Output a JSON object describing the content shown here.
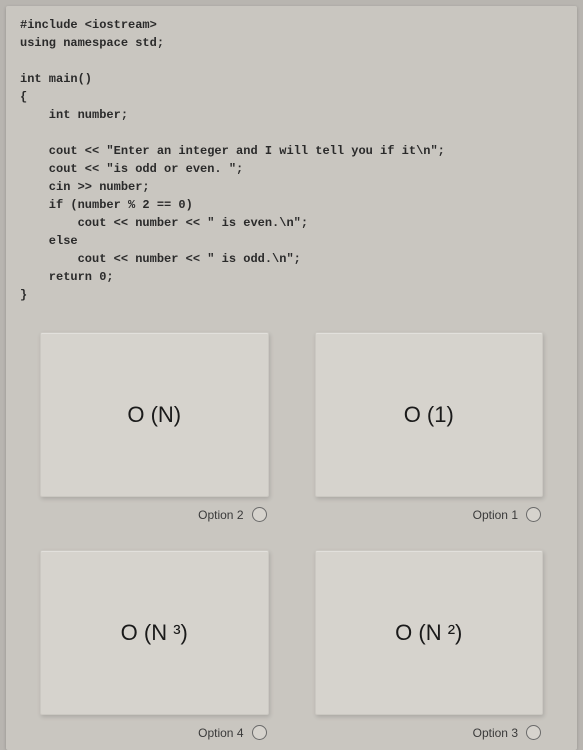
{
  "code": "#include <iostream>\nusing namespace std;\n\nint main()\n{\n    int number;\n\n    cout << \"Enter an integer and I will tell you if it\\n\";\n    cout << \"is odd or even. \";\n    cin >> number;\n    if (number % 2 == 0)\n        cout << number << \" is even.\\n\";\n    else\n        cout << number << \" is odd.\\n\";\n    return 0;\n}",
  "options": {
    "opt1": {
      "label": "O (N)",
      "footer": "Option 2"
    },
    "opt2": {
      "label": "O (1)",
      "footer": "Option 1"
    },
    "opt3": {
      "label": "O (N ³)",
      "footer": "Option 4"
    },
    "opt4": {
      "label": "O (N ²)",
      "footer": "Option 3"
    }
  }
}
